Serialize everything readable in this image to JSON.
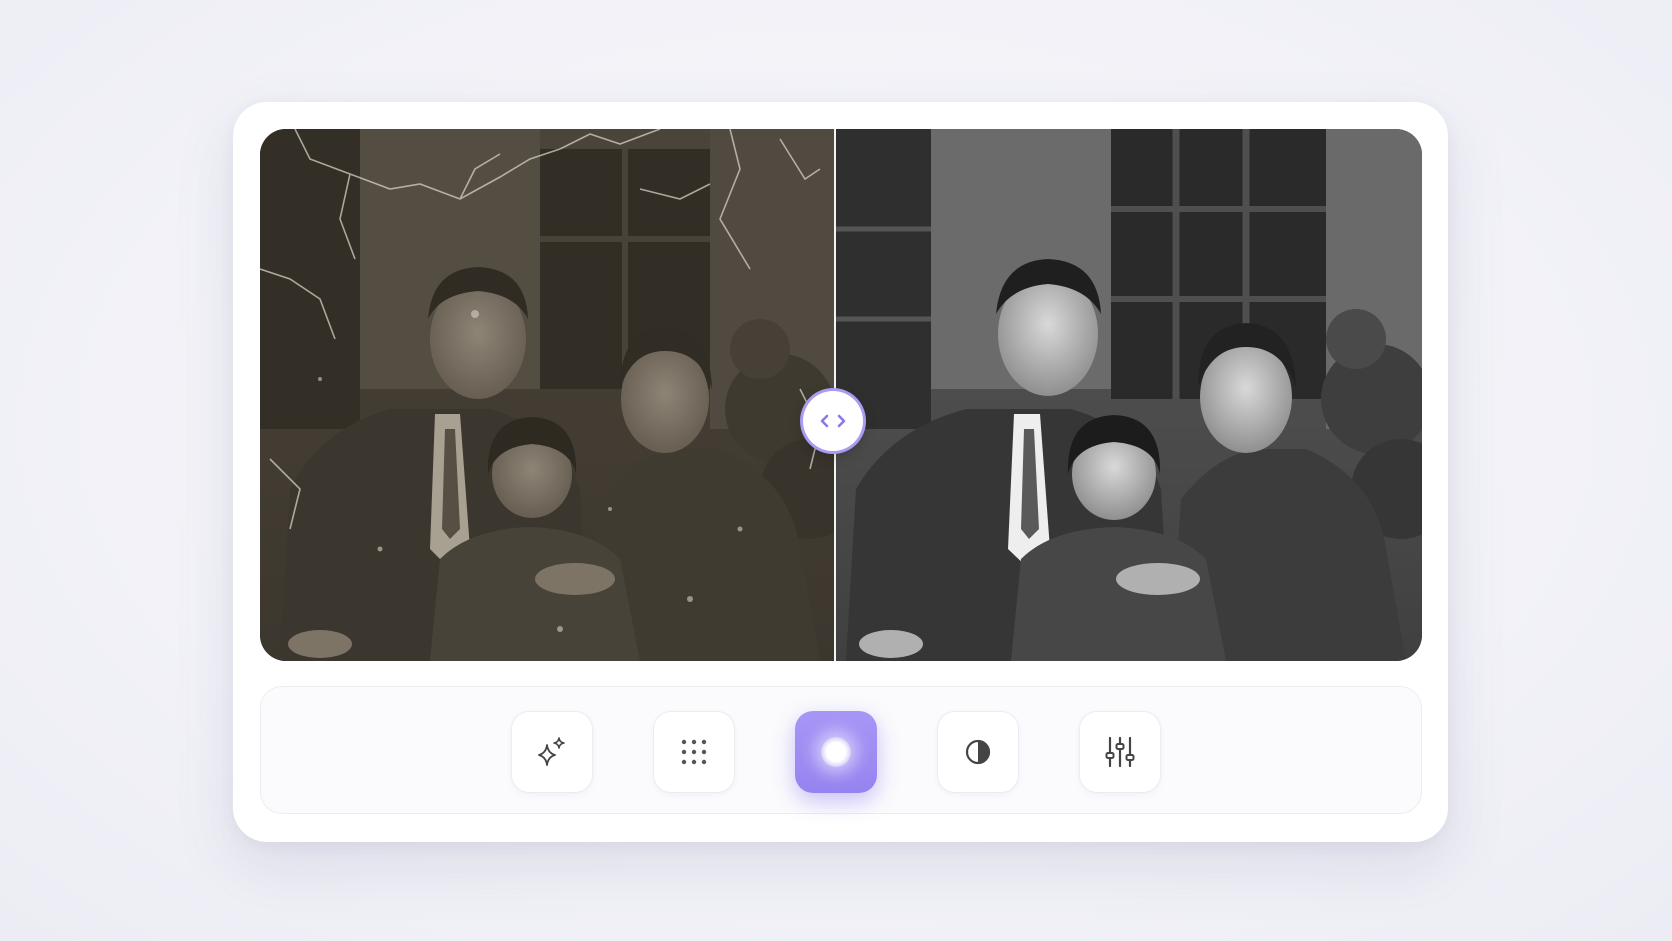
{
  "app": {
    "accent_color": "#9c8af2",
    "background_color": "#f2f2f8"
  },
  "compare": {
    "before_label": "original-damaged-photo",
    "after_label": "restored-photo",
    "slider_position": 0.494,
    "handle_icon": "chevrons-left-right-icon"
  },
  "toolbar": {
    "tools": [
      {
        "id": "enhance",
        "icon": "sparkles-icon",
        "active": false
      },
      {
        "id": "grid",
        "icon": "dot-grid-icon",
        "active": false
      },
      {
        "id": "restore",
        "icon": "glow-dot-icon",
        "active": true
      },
      {
        "id": "contrast",
        "icon": "contrast-icon",
        "active": false
      },
      {
        "id": "adjust",
        "icon": "sliders-icon",
        "active": false
      }
    ]
  }
}
